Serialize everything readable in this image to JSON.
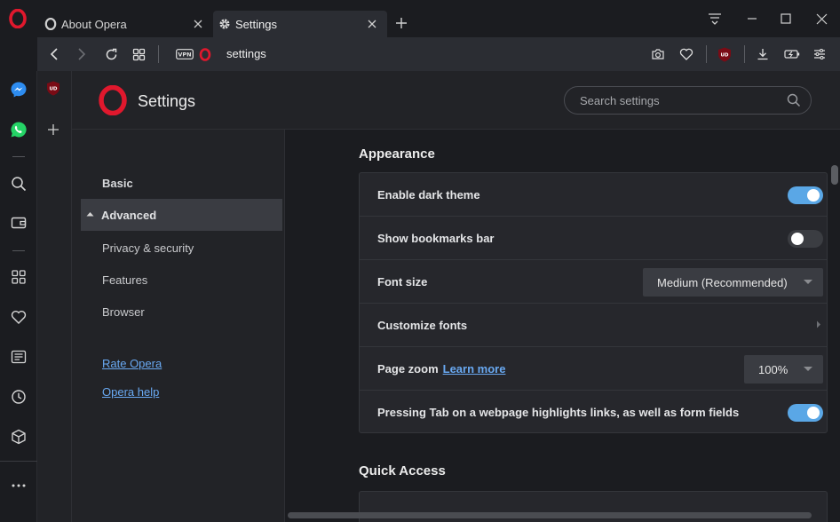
{
  "tabs": [
    {
      "label": "About Opera",
      "icon": "opera-icon"
    },
    {
      "label": "Settings",
      "icon": "gear-icon",
      "active": true
    }
  ],
  "addressbar": {
    "url": "settings",
    "vpn_badge": "VPN"
  },
  "extension": {
    "ublock_label": "UD"
  },
  "settings_header": {
    "title": "Settings",
    "search_placeholder": "Search settings"
  },
  "nav": {
    "basic": "Basic",
    "advanced": "Advanced",
    "privacy": "Privacy & security",
    "features": "Features",
    "browser": "Browser",
    "rate": "Rate Opera",
    "help": "Opera help"
  },
  "appearance": {
    "title": "Appearance",
    "rows": {
      "dark_theme": {
        "label": "Enable dark theme",
        "enabled": true
      },
      "bookmarks_bar": {
        "label": "Show bookmarks bar",
        "enabled": false
      },
      "font_size": {
        "label": "Font size",
        "value": "Medium (Recommended)"
      },
      "custom_fonts": {
        "label": "Customize fonts"
      },
      "page_zoom": {
        "label": "Page zoom",
        "link": "Learn more",
        "value": "100%"
      },
      "tab_highlight": {
        "label": "Pressing Tab on a webpage highlights links, as well as form fields",
        "enabled": true
      }
    }
  },
  "quick_access": {
    "title": "Quick Access"
  },
  "colors": {
    "accent": "#5aa7e6",
    "link": "#69a9f2",
    "opera_red": "#e0182d",
    "background": "#1b1c20"
  }
}
